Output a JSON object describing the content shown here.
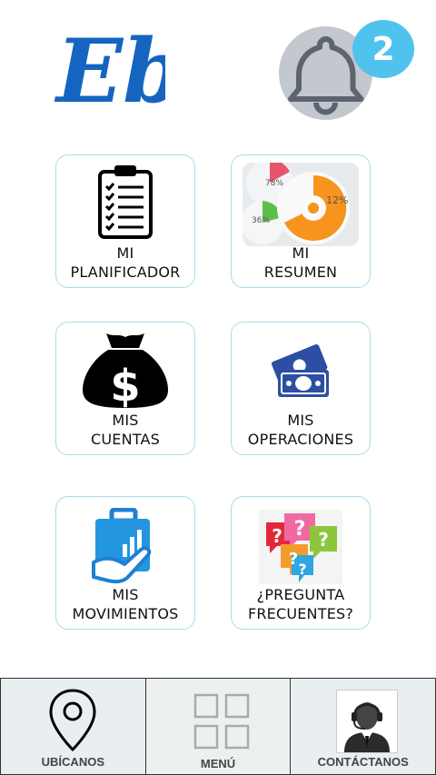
{
  "header": {
    "logo_text": "Eb",
    "notification_count": "2"
  },
  "tiles": [
    {
      "id": "planificador",
      "line1": "MI",
      "line2": "PLANIFICADOR",
      "icon": "clipboard-checklist-icon"
    },
    {
      "id": "resumen",
      "line1": "MI",
      "line2": "RESUMEN",
      "icon": "pie-summary-icon",
      "icon_texts": [
        "78%",
        "12%",
        "36%"
      ]
    },
    {
      "id": "cuentas",
      "line1": "MIS",
      "line2": "CUENTAS",
      "icon": "money-bag-icon"
    },
    {
      "id": "operaciones",
      "line1": "MIS",
      "line2": "OPERACIONES",
      "icon": "cash-bills-icon"
    },
    {
      "id": "movimientos",
      "line1": "MIS",
      "line2": "MOVIMIENTOS",
      "icon": "hand-briefcase-chart-icon"
    },
    {
      "id": "preguntas",
      "line1": "¿PREGUNTA",
      "line2": "FRECUENTES?",
      "icon": "question-bubbles-icon"
    }
  ],
  "bottom_nav": {
    "ubicanos": "UBÍCANOS",
    "menu": "MENÚ",
    "contactanos": "CONTÁCTANOS"
  },
  "colors": {
    "accent": "#1565c0",
    "badge": "#4fc3ee",
    "tile_border": "#a9dce9",
    "bell": "#c3c7ce"
  }
}
